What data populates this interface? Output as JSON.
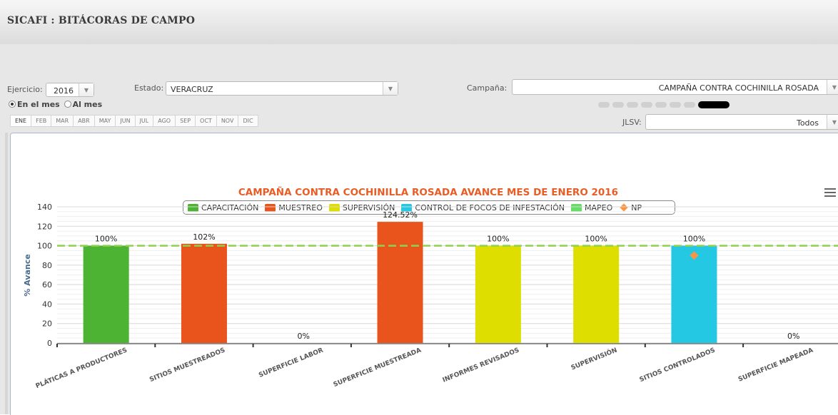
{
  "header": {
    "title": "SICAFI : BITÁCORAS DE CAMPO"
  },
  "filters": {
    "ejercicio_label": "Ejercicio:",
    "ejercicio_value": "2016",
    "estado_label": "Estado:",
    "estado_value": "VERACRUZ",
    "campana_label": "Campaña:",
    "campana_value": "CAMPAÑA CONTRA COCHINILLA ROSADA",
    "jlsv_label": "JLSV:",
    "jlsv_value": "Todos",
    "radio_en_mes": "En el mes",
    "radio_al_mes": "Al mes",
    "months": [
      "ENE",
      "FEB",
      "MAR",
      "ABR",
      "MAY",
      "JUN",
      "JUL",
      "AGO",
      "SEP",
      "OCT",
      "NOV",
      "DIC"
    ]
  },
  "chart_data": {
    "type": "bar",
    "title": "CAMPAÑA CONTRA COCHINILLA ROSADA AVANCE MES DE ENERO 2016",
    "ylabel": "% Avance",
    "ylim": [
      0,
      140
    ],
    "yticks": [
      0,
      20,
      40,
      60,
      80,
      100,
      120,
      140
    ],
    "target_line": 100,
    "legend_position": "top-center",
    "legend": [
      {
        "name": "CAPACITACIÓN",
        "color": "#4db332"
      },
      {
        "name": "MUESTREO",
        "color": "#e8541c"
      },
      {
        "name": "SUPERVISIÓN",
        "color": "#dede00"
      },
      {
        "name": "CONTROL DE FOCOS DE INFESTACIÓN",
        "color": "#25c8e3"
      },
      {
        "name": "MAPEO",
        "color": "#66dd66"
      },
      {
        "name": "NP",
        "color": "#f79646",
        "marker": "diamond"
      }
    ],
    "categories": [
      "PLÁTICAS A PRODUCTORES",
      "SITIOS MUESTREADOS",
      "SUPERFICIE LABOR",
      "SUPERFICIE MUESTREADA",
      "INFORMES REVISADOS",
      "SUPERVISIÓN",
      "SITIOS CONTROLADOS",
      "SUPERFICIE MAPEADA"
    ],
    "values": [
      100,
      102,
      0,
      124.52,
      100,
      100,
      100,
      0
    ],
    "labels": [
      "100%",
      "102%",
      "0%",
      "124.52%",
      "100%",
      "100%",
      "100%",
      "0%"
    ],
    "bar_colors": [
      "#4db332",
      "#e8541c",
      "#e8541c",
      "#e8541c",
      "#dede00",
      "#dede00",
      "#25c8e3",
      "#66dd66"
    ],
    "np_points": [
      {
        "category": "SITIOS CONTROLADOS",
        "value": 90
      }
    ]
  }
}
